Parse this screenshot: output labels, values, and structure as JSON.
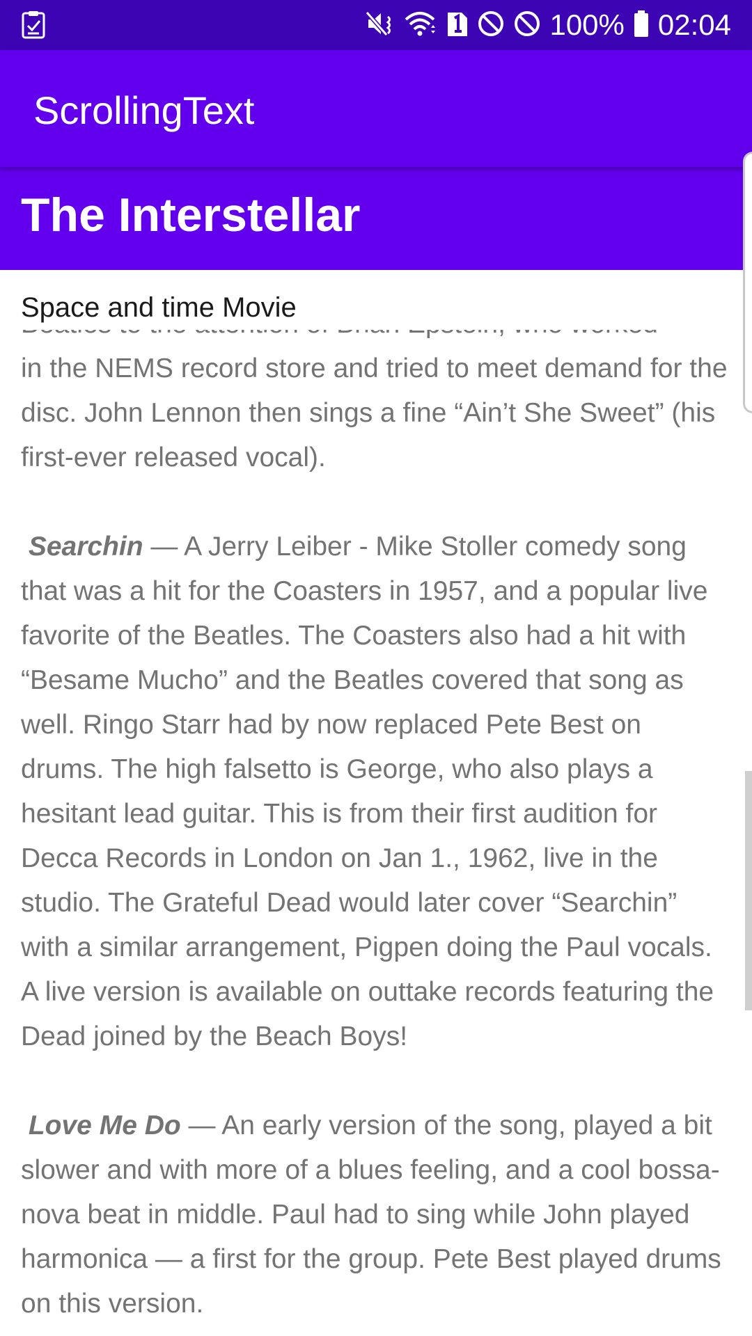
{
  "status_bar": {
    "left_icon": "task-check-icon",
    "icons": [
      "mute-icon",
      "wifi-icon",
      "sim-1-icon",
      "do-not-disturb-icon",
      "blocked-icon",
      "battery-icon"
    ],
    "battery": "100%",
    "time": "02:04"
  },
  "app_bar": {
    "title": "ScrollingText"
  },
  "article": {
    "heading": "The Interstellar",
    "subheading": "Space and time Movie",
    "partial_line": "Beatles to the attention of Brian Epstein, who worked",
    "intro_text": "in the NEMS record store and tried to meet demand for the disc. John Lennon then sings a fine “Ain’t She Sweet” (his first-ever released vocal).",
    "songs": [
      {
        "title": "Searchin",
        "dash": " — ",
        "text": "A Jerry Leiber - Mike Stoller comedy song that was a hit for the Coasters in 1957, and a popular live favorite of the Beatles. The Coasters also had a hit with “Besame Mucho” and the Beatles covered that song as well. Ringo Starr had by now replaced Pete Best on drums. The high falsetto is George, who also plays a hesitant lead guitar. This is from their first audition for Decca Records in London on Jan 1., 1962, live in the studio. The Grateful Dead would later cover “Searchin” with a similar arrangement, Pigpen doing the Paul vocals. A live version is available on outtake records featuring the Dead joined by the Beach Boys!"
      },
      {
        "title": "Love Me Do",
        "dash": " — ",
        "text": "An early version of the song, played a bit slower and with more of a blues feeling, and a cool bossa-nova beat in middle. Paul had to sing while John played harmonica — a first for the group. Pete Best played drums on this version."
      }
    ]
  }
}
